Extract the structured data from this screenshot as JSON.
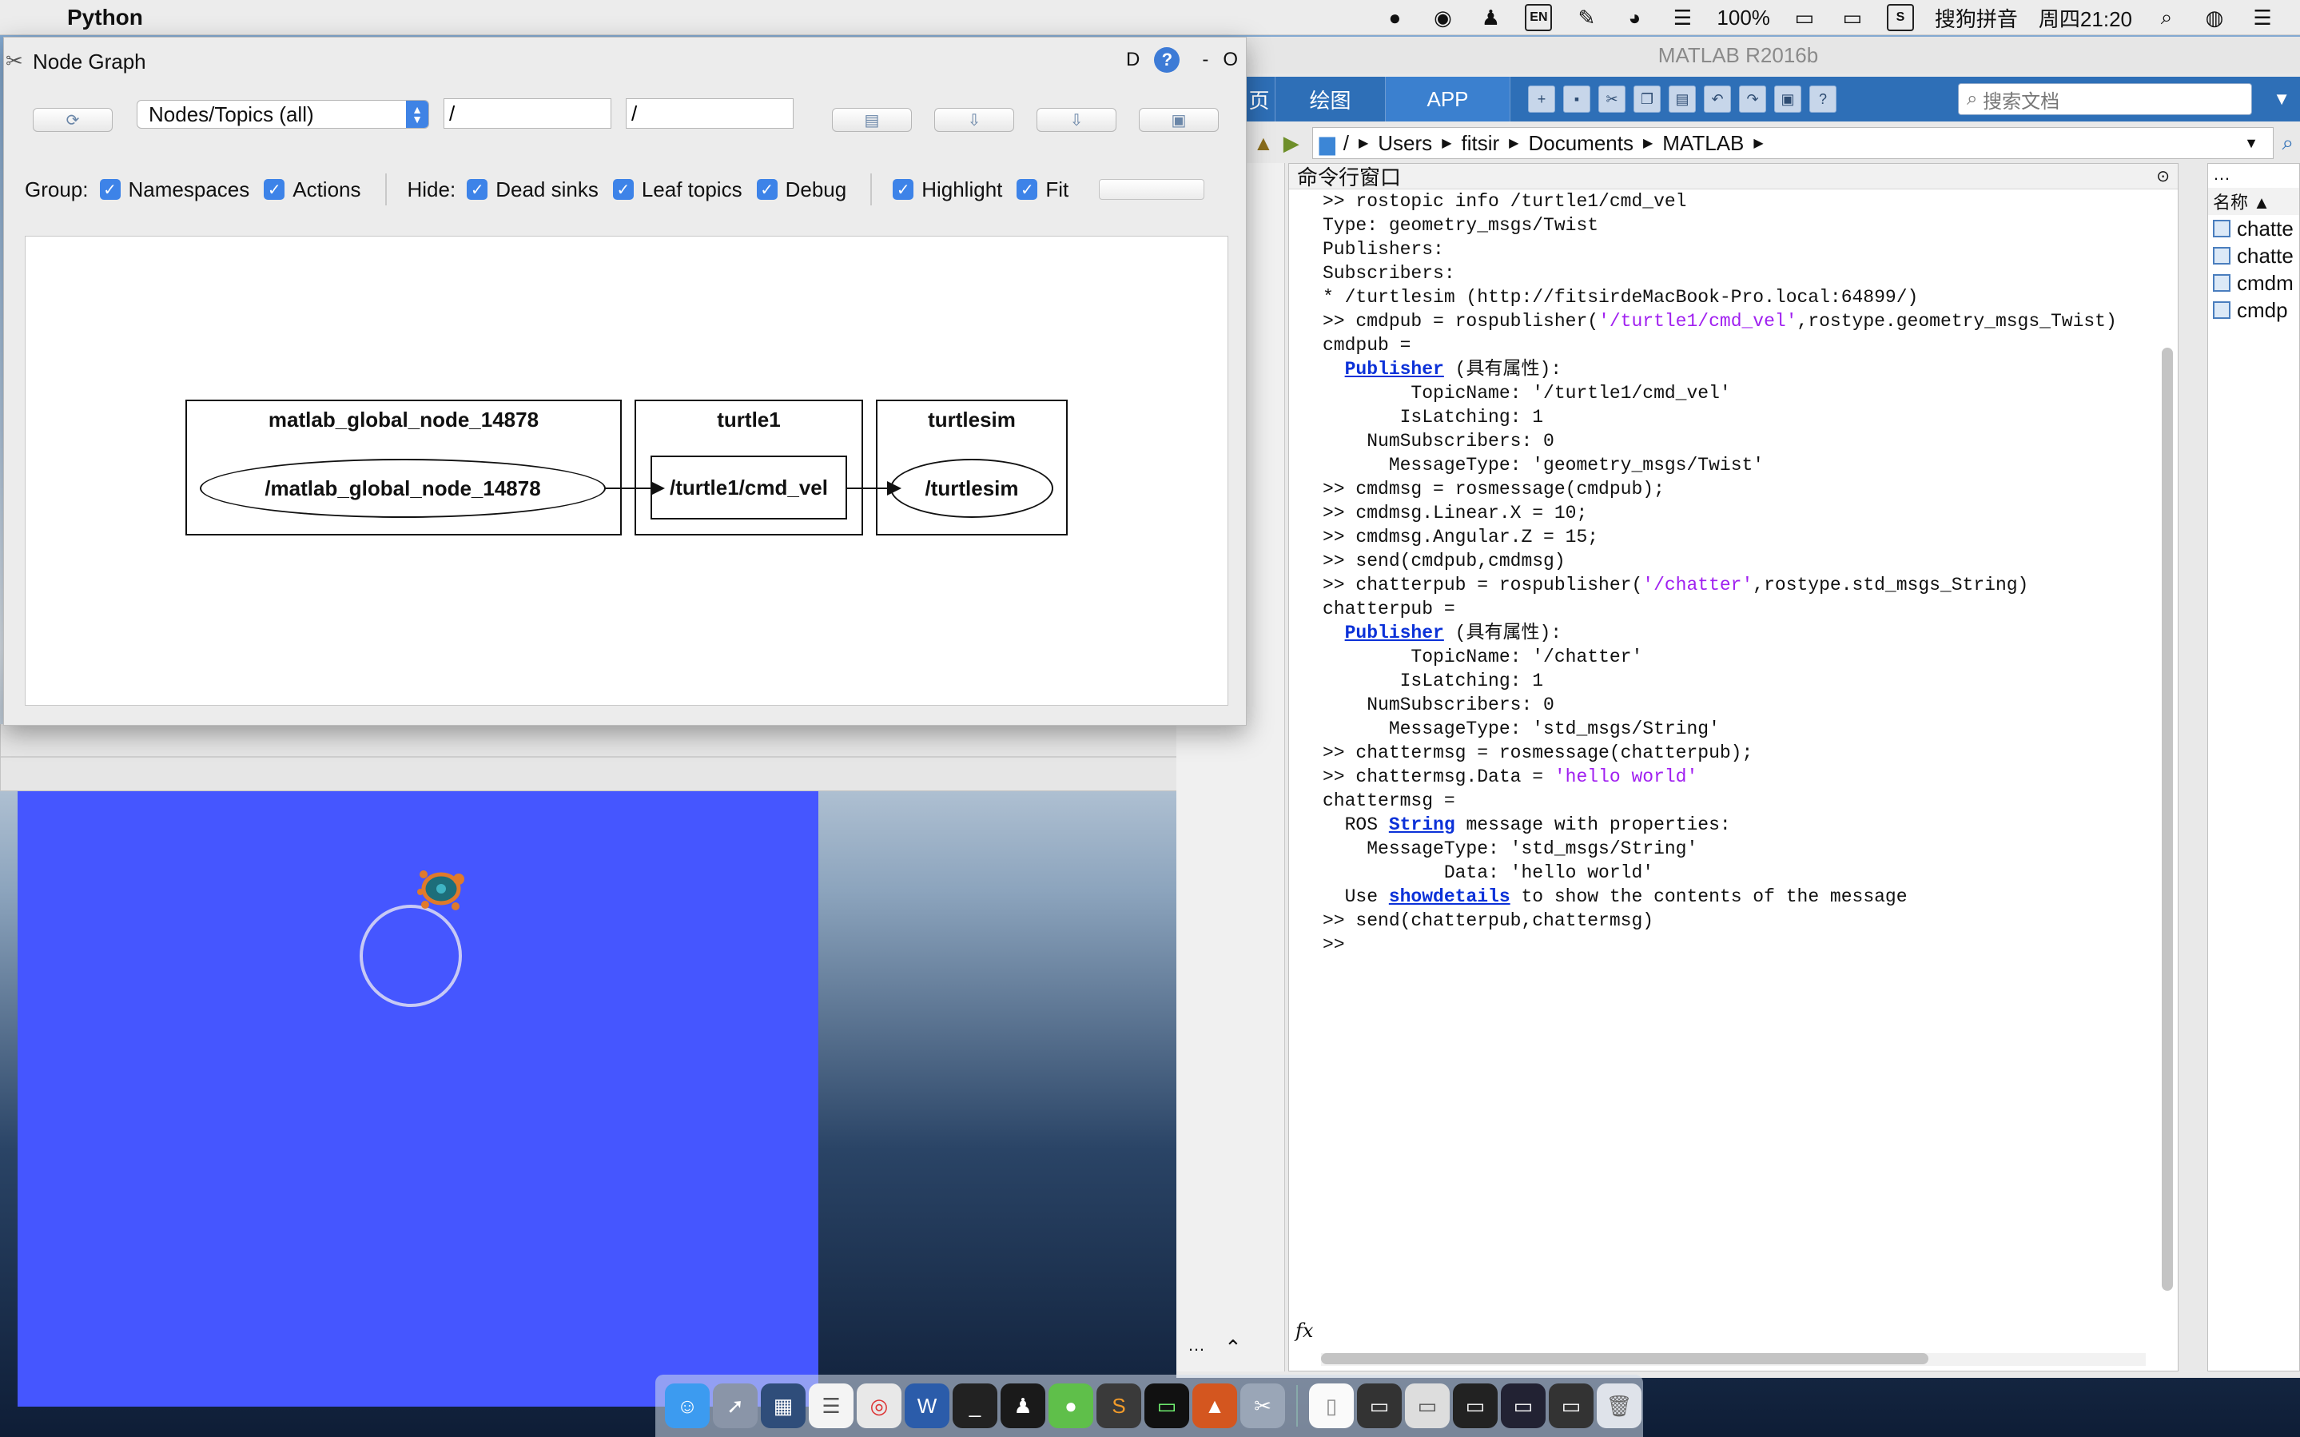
{
  "menubar": {
    "app_name": "Python",
    "battery": "100%",
    "ime": "搜狗拼音",
    "clock": "周四21:20",
    "lang_badge": "EN"
  },
  "node_graph": {
    "title": "Node Graph",
    "title_right_d": "D",
    "title_right_minus": "-",
    "title_right_o": "O",
    "select_value": "Nodes/Topics (all)",
    "filter_1": "/",
    "filter_2": "/",
    "group_label": "Group:",
    "cb_namespaces": "Namespaces",
    "cb_actions": "Actions",
    "hide_label": "Hide:",
    "cb_dead_sinks": "Dead sinks",
    "cb_leaf_topics": "Leaf topics",
    "cb_debug": "Debug",
    "cb_highlight": "Highlight",
    "cb_fit": "Fit",
    "graph": {
      "group1_title": "matlab_global_node_14878",
      "node1": "/matlab_global_node_14878",
      "group2_title": "turtle1",
      "topic": "/turtle1/cmd_vel",
      "group3_title": "turtlesim",
      "node2": "/turtlesim"
    }
  },
  "matlab": {
    "title": "MATLAB R2016b",
    "tab_home_partial": "页",
    "tab_plots": "绘图",
    "tab_apps": "APP",
    "search_placeholder": "搜索文档",
    "path": [
      "/",
      "Users",
      "fitsir",
      "Documents",
      "MATLAB"
    ],
    "cmd_window_title": "命令行窗口",
    "workspace_header": "名称 ▲",
    "workspace_vars": [
      "chatte",
      "chatte",
      "cmdm",
      "cmdp"
    ],
    "command_lines": [
      ">> rostopic info /turtle1/cmd_vel",
      "Type: geometry_msgs/Twist",
      "",
      "Publishers:",
      "",
      "Subscribers:",
      "* /turtlesim (http://fitsirdeMacBook-Pro.local:64899/)",
      ">> cmdpub = rospublisher('/turtle1/cmd_vel',rostype.geometry_msgs_Twist)",
      "",
      "cmdpub =",
      "",
      "  Publisher (具有属性):",
      "",
      "        TopicName: '/turtle1/cmd_vel'",
      "       IsLatching: 1",
      "    NumSubscribers: 0",
      "      MessageType: 'geometry_msgs/Twist'",
      "",
      ">> cmdmsg = rosmessage(cmdpub);",
      ">> cmdmsg.Linear.X = 10;",
      ">> cmdmsg.Angular.Z = 15;",
      ">> send(cmdpub,cmdmsg)",
      ">> chatterpub = rospublisher('/chatter',rostype.std_msgs_String)",
      "",
      "chatterpub =",
      "",
      "  Publisher (具有属性):",
      "",
      "        TopicName: '/chatter'",
      "       IsLatching: 1",
      "    NumSubscribers: 0",
      "      MessageType: 'std_msgs/String'",
      "",
      ">> chattermsg = rosmessage(chatterpub);",
      ">> chattermsg.Data = 'hello world'",
      "",
      "chattermsg =",
      "",
      "  ROS String message with properties:",
      "",
      "    MessageType: 'std_msgs/String'",
      "           Data: 'hello world'",
      "",
      "  Use showdetails to show the contents of the message",
      "",
      ">> send(chatterpub,chattermsg)",
      ">>"
    ],
    "prompt_fx": "fx"
  },
  "colors": {
    "turtlesim_bg": "#4556ff",
    "matlab_ribbon": "#2e6fb7",
    "checkbox": "#3d83e8"
  }
}
